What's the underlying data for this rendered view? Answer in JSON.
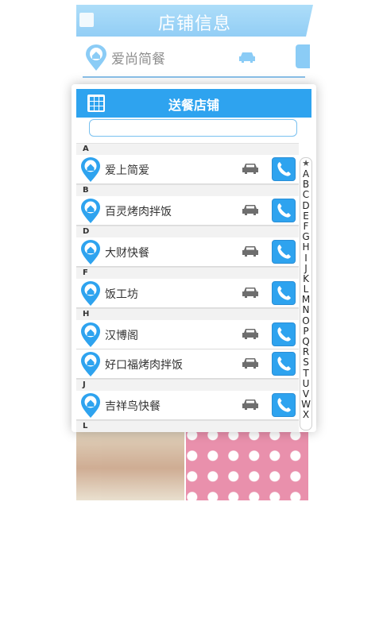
{
  "background": {
    "header_title": "店铺信息",
    "shop_name": "爱尚简餐"
  },
  "panel": {
    "title": "送餐店铺",
    "search": {
      "value": "",
      "placeholder": ""
    },
    "sections": [
      {
        "letter": "A",
        "items": [
          {
            "name": "爱上简爱"
          }
        ]
      },
      {
        "letter": "B",
        "items": [
          {
            "name": "百灵烤肉拌饭"
          }
        ]
      },
      {
        "letter": "D",
        "items": [
          {
            "name": "大财快餐"
          }
        ]
      },
      {
        "letter": "F",
        "items": [
          {
            "name": "饭工坊"
          }
        ]
      },
      {
        "letter": "H",
        "items": [
          {
            "name": "汉博阁"
          },
          {
            "name": "好口福烤肉拌饭"
          }
        ]
      },
      {
        "letter": "J",
        "items": [
          {
            "name": "吉祥鸟快餐"
          }
        ]
      },
      {
        "letter": "L",
        "items": []
      }
    ],
    "index_star": "★",
    "index_letters": [
      "A",
      "B",
      "C",
      "D",
      "E",
      "F",
      "G",
      "H",
      "I",
      "J",
      "K",
      "L",
      "M",
      "N",
      "O",
      "P",
      "Q",
      "R",
      "S",
      "T",
      "U",
      "V",
      "W",
      "X"
    ]
  },
  "icons": {
    "pin": "map-pin-icon",
    "car": "car-icon",
    "phone": "phone-icon",
    "menu": "grid-menu-icon"
  },
  "colors": {
    "accent": "#2ea3ef",
    "text": "#333333"
  }
}
